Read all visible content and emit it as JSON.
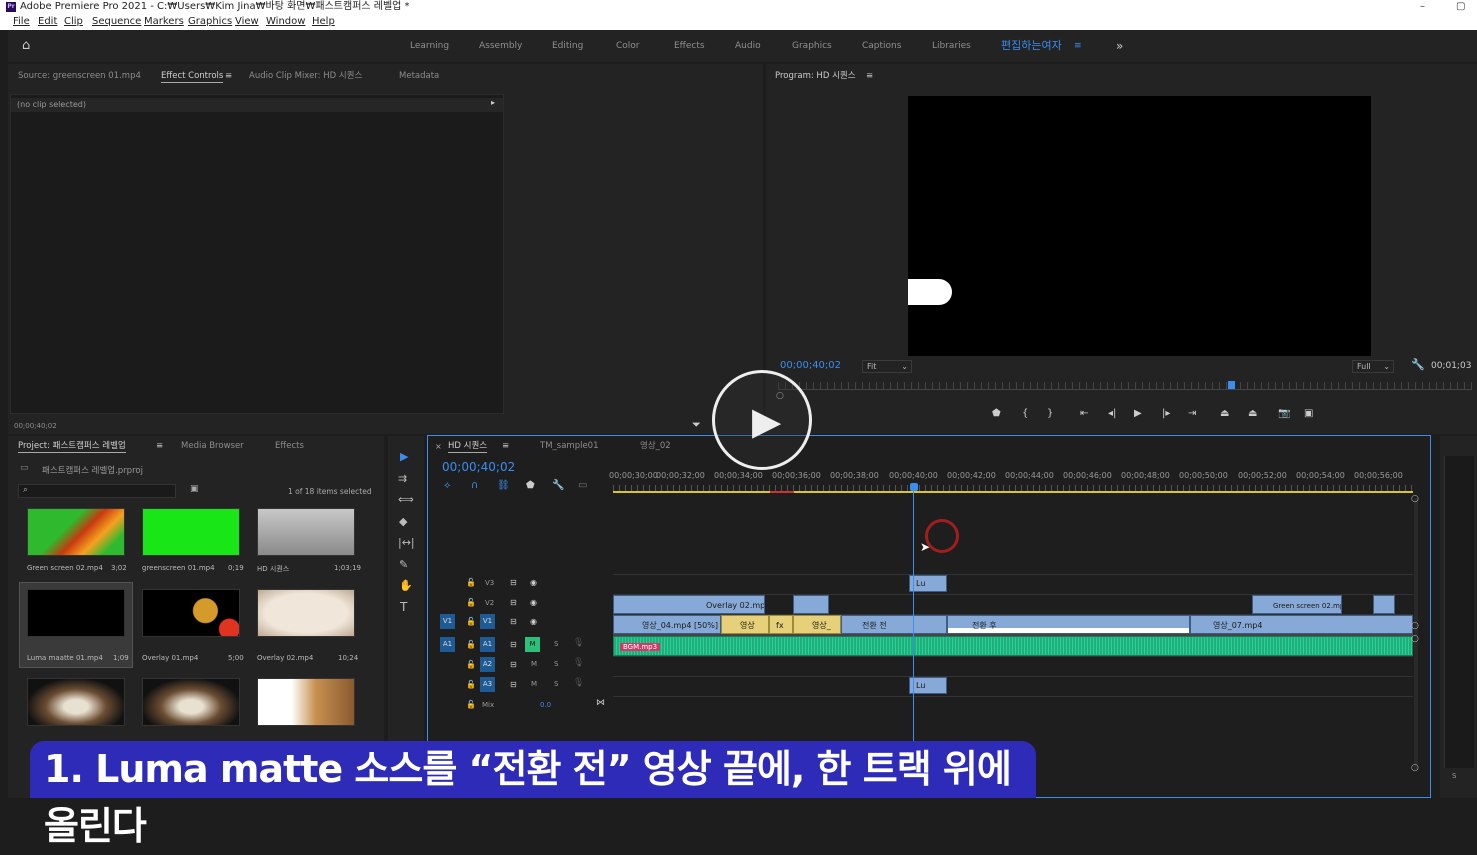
{
  "window": {
    "title": "Adobe Premiere Pro 2021 - C:₩Users₩Kim Jina₩바탕 화면₩패스트캠퍼스 레벨업 *",
    "app_badge": "Pr",
    "min": "–",
    "restore": "▢"
  },
  "menu": [
    "File",
    "Edit",
    "Clip",
    "Sequence",
    "Markers",
    "Graphics",
    "View",
    "Window",
    "Help"
  ],
  "workspaces": [
    "Learning",
    "Assembly",
    "Editing",
    "Color",
    "Effects",
    "Audio",
    "Graphics",
    "Captions",
    "Libraries"
  ],
  "active_workspace": "편집하는여자",
  "overflow": "»",
  "source_panel": {
    "tabs": [
      "Source: greenscreen 01.mp4",
      "Effect Controls",
      "Audio Clip Mixer: HD 시퀀스",
      "Metadata"
    ],
    "active_tab": "Effect Controls",
    "no_clip": "(no clip selected)",
    "timecode": "00;00;40;02"
  },
  "program": {
    "title": "Program: HD 시퀀스",
    "timecode": "00;00;40;02",
    "fit": "Fit",
    "quality": "Full",
    "duration": "00;01;03"
  },
  "project": {
    "tabs": [
      "Project: 패스트캠퍼스 레벨업",
      "Media Browser",
      "Effects"
    ],
    "file": "패스트캠퍼스 레벨업.prproj",
    "selection": "1 of 18 items selected",
    "items": [
      {
        "name": "Green screen 02.mp4",
        "dur": "3;02"
      },
      {
        "name": "greenscreen 01.mp4",
        "dur": "0;19"
      },
      {
        "name": "HD 시퀀스",
        "dur": "1;03;19"
      },
      {
        "name": "Luma maatte 01.mp4",
        "dur": "1;09"
      },
      {
        "name": "Overlay 01.mp4",
        "dur": "5;00"
      },
      {
        "name": "Overlay 02.mp4",
        "dur": "10;24"
      },
      {
        "name": "",
        "dur": ""
      },
      {
        "name": "",
        "dur": ""
      },
      {
        "name": "",
        "dur": ""
      }
    ]
  },
  "timeline": {
    "tabs": [
      "HD 시퀀스",
      "TM_sample01",
      "영상_02"
    ],
    "timecode": "00;00;40;02",
    "ruler": [
      "00;00;30;00",
      "00;00;32;00",
      "00;00;34;00",
      "00;00;36;00",
      "00;00;38;00",
      "00;00;40;00",
      "00;00;42;00",
      "00;00;44;00",
      "00;00;46;00",
      "00;00;48;00",
      "00;00;50;00",
      "00;00;52;00",
      "00;00;54;00",
      "00;00;56;00"
    ],
    "tracks": {
      "v3": "V3",
      "v2": "V2",
      "v1": "V1",
      "a1": "A1",
      "a2": "A2",
      "a3": "A3",
      "mix": "Mix",
      "mix_val": "0.0",
      "src_v": "V1",
      "src_a": "A1",
      "m": "M",
      "s": "S"
    },
    "clips": {
      "lu_v3": "Lu",
      "overlay02": "Overlay 02.mp4",
      "green02": "Green screen 02.mp",
      "v04": "영상_04.mp4 [50%]",
      "v_a": "영상",
      "v_b": "영상_",
      "before": "전환 전",
      "after": "전환 후",
      "v07": "영상_07.mp4",
      "bgm": "BGM.mp3",
      "lu_a3": "Lu",
      "fx": "fx"
    }
  },
  "caption": "1. Luma matte 소스를 “전환 전” 영상 끝에, 한 트랙 위에 올린다"
}
